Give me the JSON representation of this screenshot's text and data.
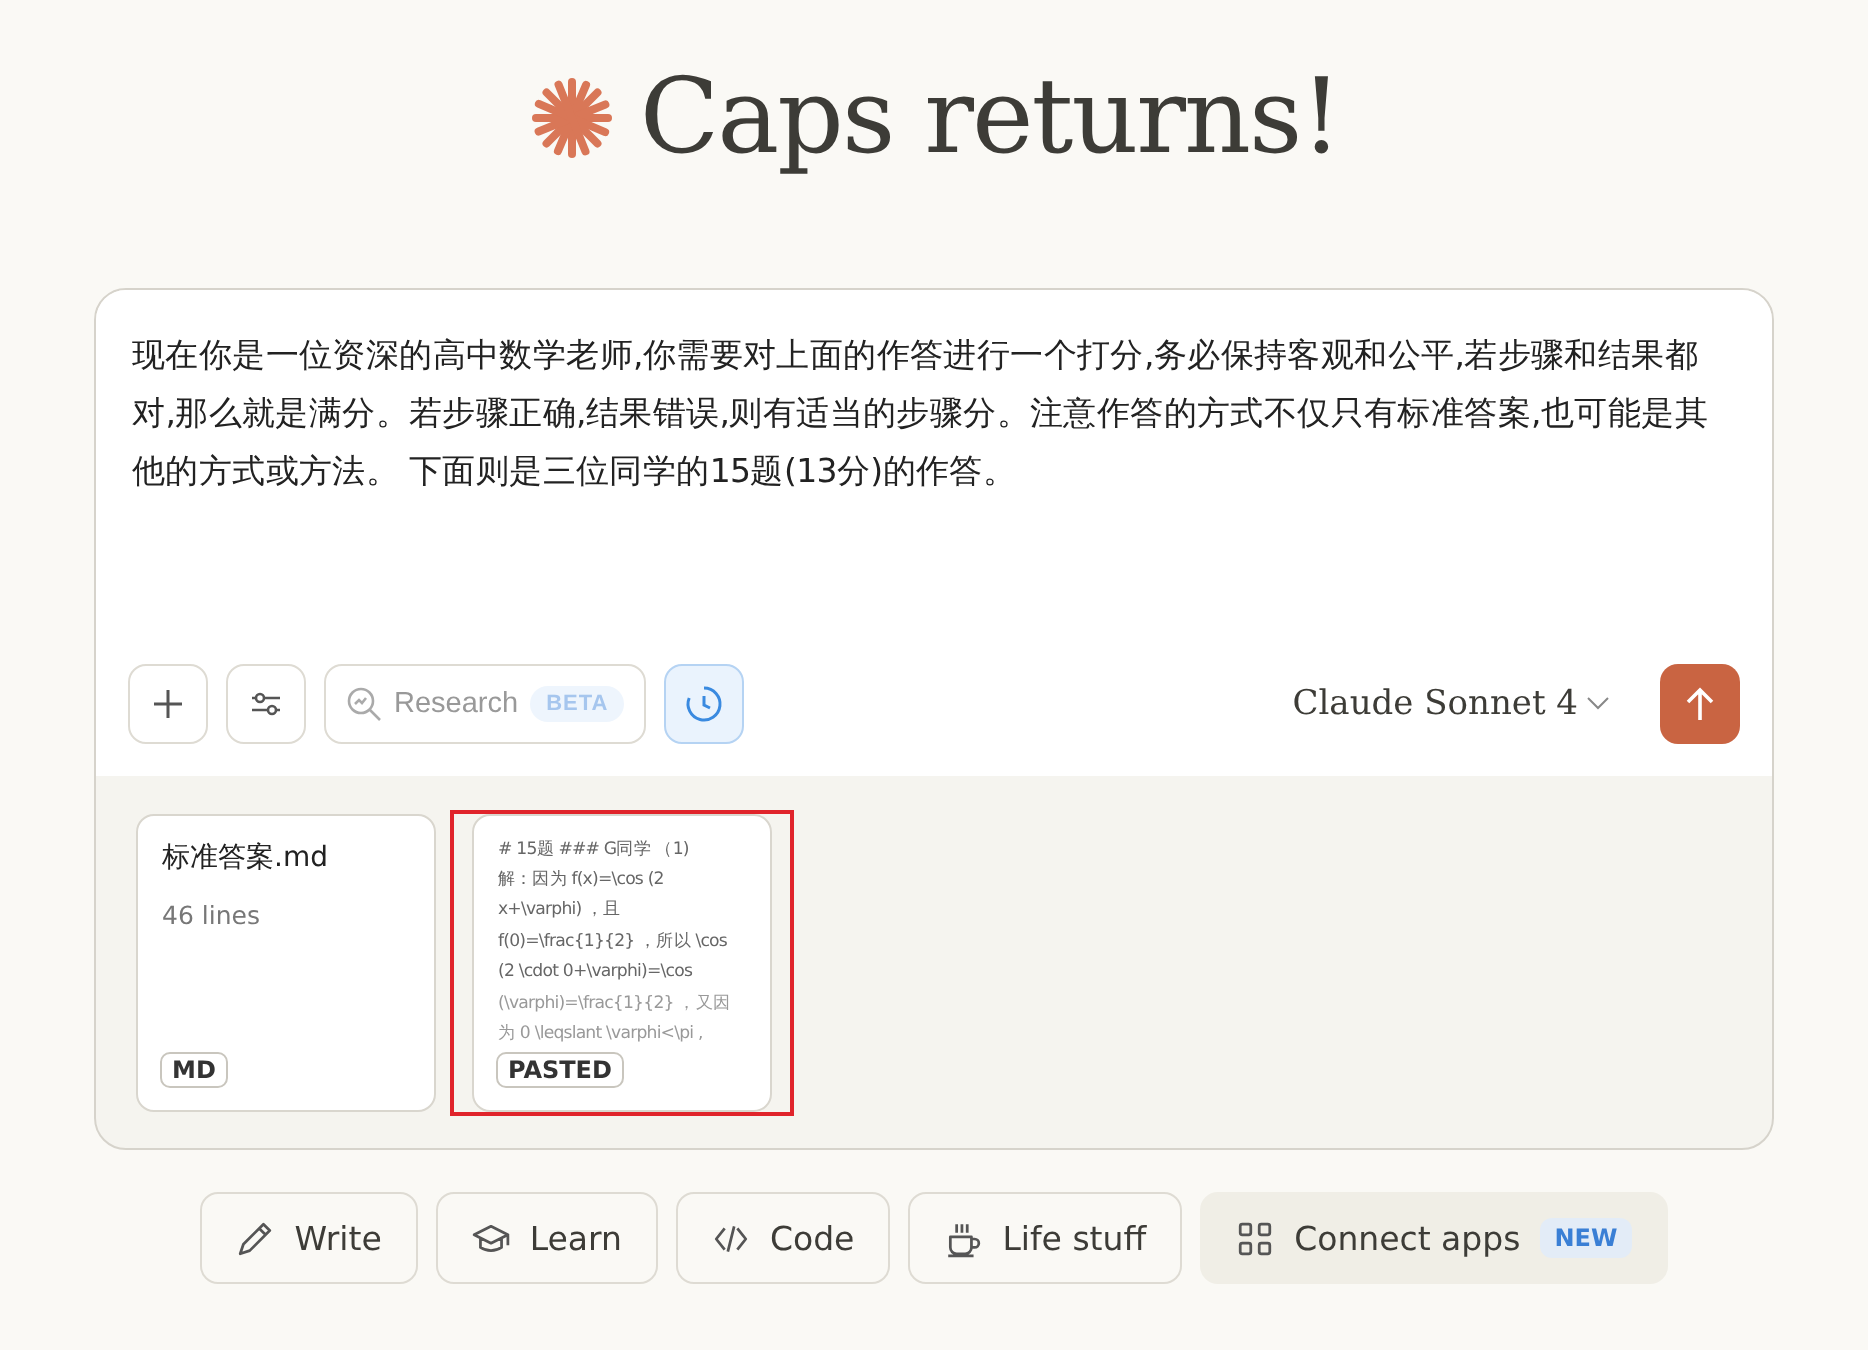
{
  "title": "Caps returns!",
  "prompt": {
    "value": "现在你是一位资深的高中数学老师,你需要对上面的作答进行一个打分,务必保持客观和公平,若步骤和结果都对,那么就是满分。若步骤正确,结果错误,则有适当的步骤分。注意作答的方式不仅只有标准答案,也可能是其他的方式或方法。 下面则是三位同学的15题(13分)的作答。"
  },
  "toolbar": {
    "research": {
      "label": "Research",
      "badge": "BETA",
      "selected": false
    },
    "extended_thinking": {
      "selected": true
    },
    "model": "Claude Sonnet 4"
  },
  "attachments": [
    {
      "kind": "file",
      "name": "标准答案.md",
      "meta": "46 lines",
      "badge": "MD",
      "highlighted": false
    },
    {
      "kind": "pasted",
      "lines": [
        "# 15题 ### G同学 （1)",
        "解：因为 f(x)=\\cos (2",
        "x+\\varphi) ，且",
        "f(0)=\\frac{1}{2} ，所以 \\cos",
        "(2 \\cdot 0+\\varphi)=\\cos",
        "(\\varphi)=\\frac{1}{2} ，又因",
        "为 0 \\leqslant \\varphi<\\pi ,"
      ],
      "badge": "PASTED",
      "highlighted": true
    }
  ],
  "chips": [
    {
      "label": "Write"
    },
    {
      "label": "Learn"
    },
    {
      "label": "Code"
    },
    {
      "label": "Life stuff"
    },
    {
      "label": "Connect apps",
      "badge": "NEW"
    }
  ]
}
